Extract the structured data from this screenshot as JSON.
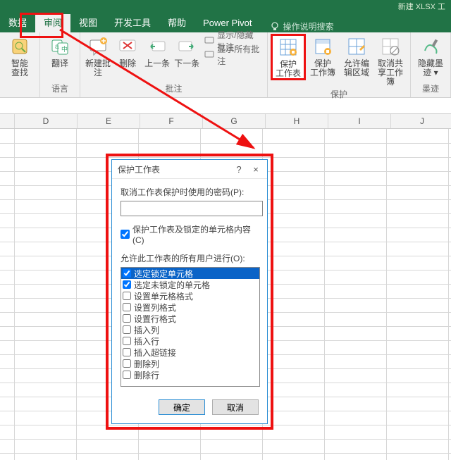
{
  "titlebar": "新建 XLSX 工",
  "tabs": {
    "items": [
      "数据",
      "审阅",
      "视图",
      "开发工具",
      "帮助",
      "Power Pivot"
    ],
    "active_index": 1,
    "tellme": "操作说明搜索"
  },
  "ribbon": {
    "groups": [
      {
        "label": "",
        "big": [
          {
            "text1": "智能",
            "text2": "查找",
            "icon": "search"
          }
        ]
      },
      {
        "label": "语言",
        "big": [
          {
            "text1": "翻译",
            "text2": "",
            "icon": "translate"
          }
        ]
      },
      {
        "label": "批注",
        "big": [
          {
            "text1": "新建批注",
            "text2": "",
            "icon": "newcomment"
          },
          {
            "text1": "删除",
            "text2": "",
            "icon": "delete"
          },
          {
            "text1": "上一条",
            "text2": "",
            "icon": "prev"
          },
          {
            "text1": "下一条",
            "text2": "",
            "icon": "next"
          }
        ],
        "small": [
          "显示/隐藏批注",
          "显示所有批注"
        ]
      },
      {
        "label": "保护",
        "big": [
          {
            "text1": "保护",
            "text2": "工作表",
            "icon": "protectsheet",
            "highlight": true
          },
          {
            "text1": "保护",
            "text2": "工作簿",
            "icon": "protectwb"
          },
          {
            "text1": "允许编",
            "text2": "辑区域",
            "icon": "allowedit"
          },
          {
            "text1": "取消共",
            "text2": "享工作簿",
            "icon": "unshare"
          }
        ]
      },
      {
        "label": "墨迹",
        "big": [
          {
            "text1": "隐藏墨",
            "text2": "迹 ▾",
            "icon": "ink"
          }
        ]
      }
    ]
  },
  "columns": [
    "D",
    "E",
    "F",
    "G",
    "H",
    "I",
    "J"
  ],
  "dialog": {
    "title": "保护工作表",
    "help": "?",
    "close": "×",
    "password_label": "取消工作表保护时使用的密码(P):",
    "password_value": "",
    "protect_checkbox": {
      "checked": true,
      "label": "保护工作表及锁定的单元格内容(C)"
    },
    "perm_label": "允许此工作表的所有用户进行(O):",
    "perm_items": [
      {
        "checked": true,
        "label": "选定锁定单元格",
        "selected": true
      },
      {
        "checked": true,
        "label": "选定未锁定的单元格"
      },
      {
        "checked": false,
        "label": "设置单元格格式"
      },
      {
        "checked": false,
        "label": "设置列格式"
      },
      {
        "checked": false,
        "label": "设置行格式"
      },
      {
        "checked": false,
        "label": "插入列"
      },
      {
        "checked": false,
        "label": "插入行"
      },
      {
        "checked": false,
        "label": "插入超链接"
      },
      {
        "checked": false,
        "label": "删除列"
      },
      {
        "checked": false,
        "label": "删除行"
      }
    ],
    "ok": "确定",
    "cancel": "取消"
  }
}
